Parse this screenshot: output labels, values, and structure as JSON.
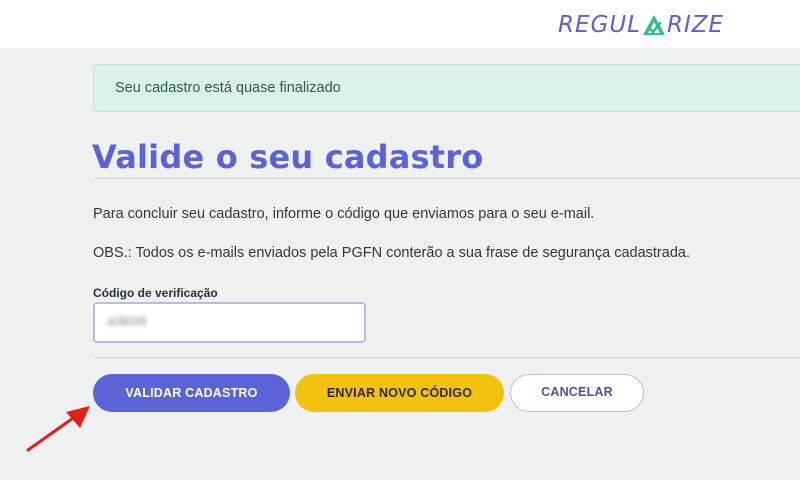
{
  "brand": {
    "logo_left": "REGUL",
    "logo_right": "RIZE",
    "logo_color": "#5a5fd8",
    "accent_green": "#2fbf8c"
  },
  "alert": {
    "message": "Seu cadastro está quase finalizado"
  },
  "page": {
    "title": "Valide o seu cadastro",
    "instruction": "Para concluir seu cadastro, informe o código que enviamos para o seu e-mail.",
    "note": "OBS.: Todos os e-mails enviados pela PGFN conterão a sua frase de segurança cadastrada."
  },
  "form": {
    "code_label": "Código de verificação",
    "code_value": "ai3k0r8"
  },
  "buttons": {
    "validate": "VALIDAR CADASTRO",
    "resend": "ENVIAR NOVO CÓDIGO",
    "cancel": "CANCELAR"
  },
  "colors": {
    "primary": "#5b63d9",
    "warning": "#f3c20f",
    "annotation_arrow": "#e0201b"
  }
}
